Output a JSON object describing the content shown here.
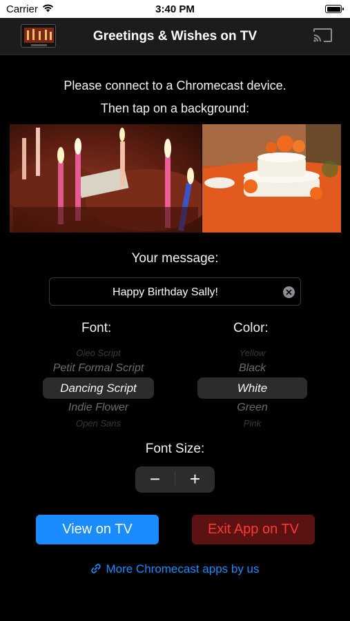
{
  "status_bar": {
    "carrier": "Carrier",
    "time": "3:40 PM"
  },
  "nav": {
    "title": "Greetings & Wishes on TV"
  },
  "instructions": {
    "line1": "Please connect to a Chromecast device.",
    "line2": "Then tap on a background:"
  },
  "backgrounds": [
    {
      "name": "birthday-candles"
    },
    {
      "name": "wedding-cake"
    }
  ],
  "message": {
    "label": "Your message:",
    "value": "Happy Birthday Sally!"
  },
  "font_picker": {
    "label": "Font:",
    "options": [
      "Oleo Script",
      "Petit Formal Script",
      "Dancing Script",
      "Indie Flower",
      "Open Sans"
    ],
    "selected": "Dancing Script"
  },
  "color_picker": {
    "label": "Color:",
    "options": [
      "Yellow",
      "Black",
      "White",
      "Green",
      "Pink"
    ],
    "selected": "White"
  },
  "font_size": {
    "label": "Font Size:",
    "minus": "−",
    "plus": "+"
  },
  "buttons": {
    "view": "View on TV",
    "exit": "Exit App on TV"
  },
  "more_link": "More Chromecast apps by us",
  "colors": {
    "accent": "#1a8cff",
    "danger": "#ff3b30",
    "danger_bg": "#5a1212"
  }
}
